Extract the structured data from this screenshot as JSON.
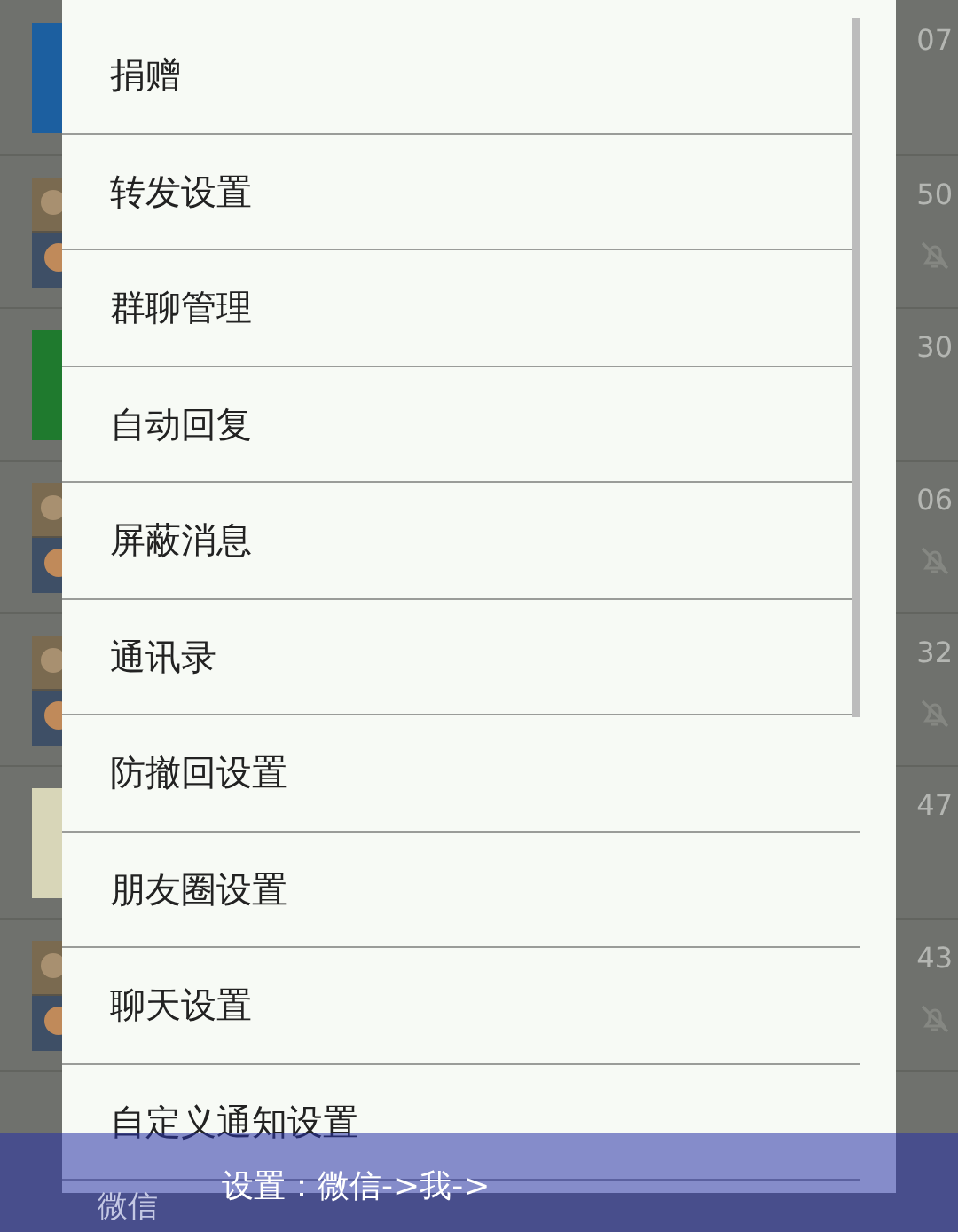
{
  "background_chats": [
    {
      "kind": "tile",
      "color": "#1c5fa0",
      "time": "07",
      "muted": false
    },
    {
      "time": "50",
      "muted": true
    },
    {
      "kind": "tile",
      "color": "#1f7a2e",
      "time": "30",
      "muted": false
    },
    {
      "time": "06",
      "muted": true
    },
    {
      "time": "32",
      "muted": true
    },
    {
      "kind": "tile",
      "color": "#d8d6b8",
      "time": "47",
      "muted": false
    },
    {
      "time": "43",
      "muted": true
    }
  ],
  "bottom_tabs": [
    "微信"
  ],
  "menu": {
    "items": [
      {
        "label": "捐赠"
      },
      {
        "label": "转发设置"
      },
      {
        "label": "群聊管理"
      },
      {
        "label": "自动回复"
      },
      {
        "label": "屏蔽消息"
      },
      {
        "label": "通讯录"
      },
      {
        "label": "防撤回设置"
      },
      {
        "label": "朋友圈设置"
      },
      {
        "label": "聊天设置"
      },
      {
        "label": "自定义通知设置"
      }
    ]
  },
  "caption": "设置：微信->我->"
}
